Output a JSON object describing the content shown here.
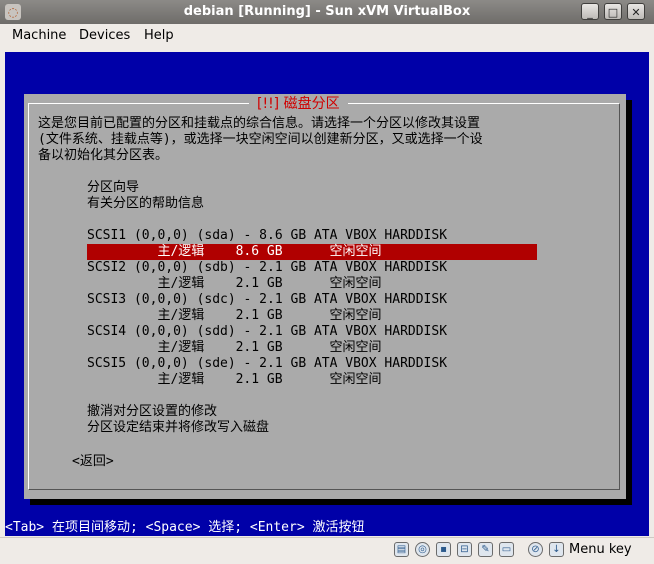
{
  "window": {
    "title": "debian [Running] - Sun xVM VirtualBox",
    "minimize": "_",
    "maximize": "□",
    "close": "✕"
  },
  "menu": {
    "items": [
      "Machine",
      "Devices",
      "Help"
    ]
  },
  "installer": {
    "dialog_title": "[!!] 磁盘分区",
    "intro_lines": [
      "这是您目前已配置的分区和挂载点的综合信息。请选择一个分区以修改其设置",
      "(文件系统、挂载点等)，或选择一块空闲空间以创建新分区，又或选择一个设",
      "备以初始化其分区表。"
    ],
    "guided_partitioning": "分区向导",
    "help_info": "有关分区的帮助信息",
    "disks": [
      {
        "header": "SCSI1 (0,0,0) (sda) - 8.6 GB ATA VBOX HARDDISK",
        "row": "         主/逻辑    8.6 GB      空闲空间           ",
        "selected": true
      },
      {
        "header": "SCSI2 (0,0,0) (sdb) - 2.1 GB ATA VBOX HARDDISK",
        "row": "         主/逻辑    2.1 GB      空闲空间",
        "selected": false
      },
      {
        "header": "SCSI3 (0,0,0) (sdc) - 2.1 GB ATA VBOX HARDDISK",
        "row": "         主/逻辑    2.1 GB      空闲空间",
        "selected": false
      },
      {
        "header": "SCSI4 (0,0,0) (sdd) - 2.1 GB ATA VBOX HARDDISK",
        "row": "         主/逻辑    2.1 GB      空闲空间",
        "selected": false
      },
      {
        "header": "SCSI5 (0,0,0) (sde) - 2.1 GB ATA VBOX HARDDISK",
        "row": "         主/逻辑    2.1 GB      空闲空间",
        "selected": false
      }
    ],
    "undo_changes": "撤消对分区设置的修改",
    "finish": "分区设定结束并将修改写入磁盘",
    "back_button": "<返回>",
    "help_line": "<Tab> 在项目间移动; <Space> 选择; <Enter> 激活按钮"
  },
  "statusbar": {
    "host_key": "Menu key",
    "icons": [
      "hard-disk-icon",
      "cd-icon",
      "floppy-icon",
      "network-icon",
      "usb-icon",
      "shared-folder-icon",
      "mouse-integration-icon",
      "host-key-icon"
    ]
  },
  "colors": {
    "vm_background": "#0000a8",
    "dialog": "#aaaaaa",
    "selection": "#b00000",
    "title_text": "#d00000"
  }
}
